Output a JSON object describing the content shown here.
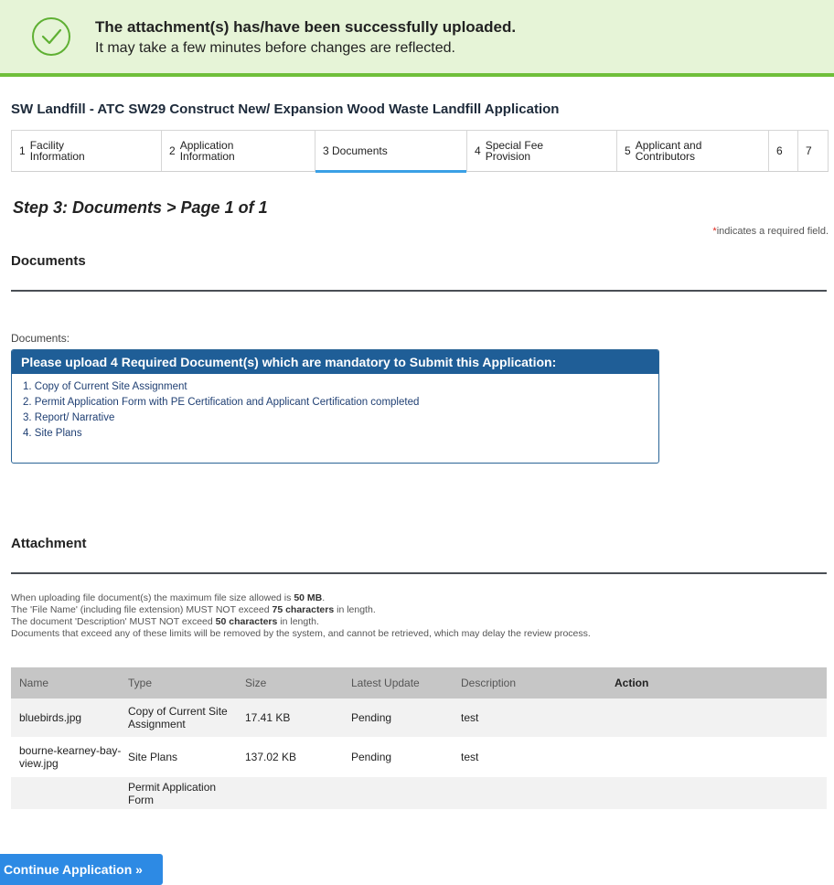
{
  "banner": {
    "title": "The attachment(s) has/have been successfully uploaded.",
    "subtitle": "It may take a few minutes before changes are reflected.",
    "icon": "check-circle-icon"
  },
  "app_title": "SW Landfill - ATC SW29 Construct New/ Expansion Wood Waste Landfill Application",
  "steps": [
    {
      "num": "1",
      "label": "Facility\nInformation"
    },
    {
      "num": "2",
      "label": "Application\nInformation"
    },
    {
      "num": "",
      "label": "3 Documents"
    },
    {
      "num": "4",
      "label": "Special Fee\nProvision"
    },
    {
      "num": "5",
      "label": "Applicant and\nContributors"
    },
    {
      "num": "6",
      "label": ""
    },
    {
      "num": "7",
      "label": ""
    }
  ],
  "step_heading": "Step 3: Documents > Page 1 of 1",
  "required_note": {
    "star": "*",
    "text": "indicates a required field."
  },
  "documents_section": {
    "title": "Documents",
    "label": "Documents:",
    "requirements_header": "Please upload 4 Required Document(s) which are mandatory to Submit this Application:",
    "requirements": [
      "1. Copy of Current Site Assignment",
      "2. Permit Application Form with PE Certification and Applicant Certification completed",
      "3. Report/ Narrative",
      "4. Site Plans"
    ]
  },
  "attachment_section": {
    "title": "Attachment",
    "info": {
      "line1_pre": "When uploading file document(s) the maximum file size allowed is ",
      "line1_bold": "50 MB",
      "line1_post": ".",
      "line2_pre": "The 'File Name' (including file extension) MUST NOT exceed ",
      "line2_bold": "75 characters",
      "line2_post": " in length.",
      "line3_pre": "The document 'Description' MUST NOT exceed ",
      "line3_bold": "50 characters",
      "line3_post": " in length.",
      "line4": "Documents that exceed any of these limits will be removed by the system, and cannot be retrieved, which may delay the review process."
    },
    "table": {
      "headers": [
        "Name",
        "Type",
        "Size",
        "Latest Update",
        "Description",
        "Action"
      ],
      "rows": [
        {
          "name": "bluebirds.jpg",
          "type": "Copy of Current Site Assignment",
          "size": "17.41 KB",
          "update": "Pending",
          "description": "test"
        },
        {
          "name": "bourne-kearney-bay-view.jpg",
          "type": "Site Plans",
          "size": "137.02 KB",
          "update": "Pending",
          "description": "test"
        },
        {
          "name": "",
          "type": "Permit Application Form",
          "size": "",
          "update": "",
          "description": ""
        }
      ]
    }
  },
  "continue_button": "Continue Application »",
  "colors": {
    "banner_bg": "#e6f4d7",
    "banner_border": "#6fbf3a",
    "requirements_header_bg": "#1f5e97",
    "button_bg": "#2d8ae4",
    "active_step_underline": "#3aa0e6"
  }
}
